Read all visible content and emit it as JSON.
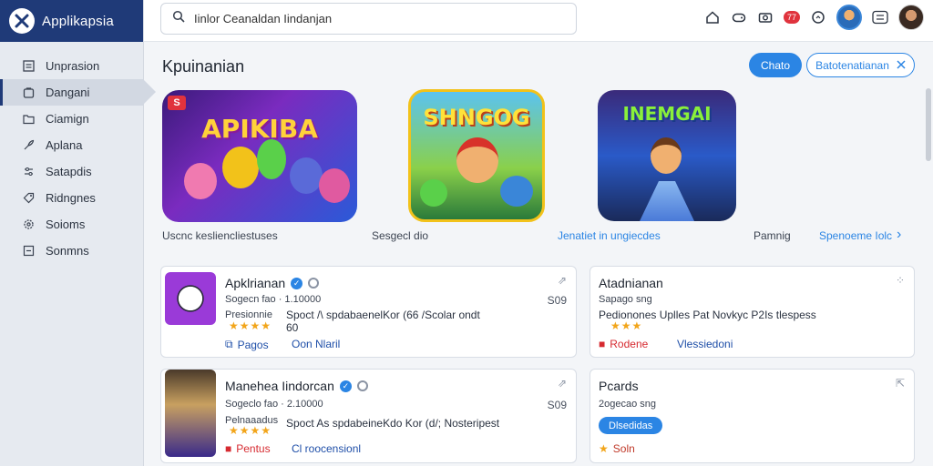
{
  "app": {
    "name": "Applikapsia"
  },
  "search": {
    "value": "Iinlor Ceanaldan Iindanjan"
  },
  "topbar": {
    "notif_count": "77"
  },
  "sidebar": {
    "items": [
      {
        "label": "Unprasion",
        "icon": "layout-icon"
      },
      {
        "label": "Dangani",
        "icon": "bag-icon",
        "active": true
      },
      {
        "label": "Ciamign",
        "icon": "folder-icon"
      },
      {
        "label": "Aplana",
        "icon": "rocket-icon"
      },
      {
        "label": "Satapdis",
        "icon": "sliders-icon"
      },
      {
        "label": "Ridngnes",
        "icon": "tag-icon"
      },
      {
        "label": "Soioms",
        "icon": "gear-icon"
      },
      {
        "label": "Sonmns",
        "icon": "box-icon"
      }
    ]
  },
  "main": {
    "title": "Kpuinanian",
    "primary_button": "Chato",
    "outline_button": "Batotenatianan",
    "tiles": [
      {
        "art_text": "APIKIBA",
        "badge": "S",
        "label": "Uscnc kesliencliestuses"
      },
      {
        "art_text": "SHNGOG",
        "label": "Sesgecl dio"
      },
      {
        "art_text": "INEMGAI",
        "label": "Jenatiet in ungiecdes"
      }
    ],
    "extra_label": "Pamnig",
    "see_more": "Spenoeme Iolc"
  },
  "cards": [
    {
      "title": "Apklrianan",
      "meta": "Sogecn fao · 1.10000",
      "rating_label": "Presionnie",
      "desc": "Spoct /\\ spdabaenelKor (66 /Scolar ondt",
      "desc2": "60",
      "stars": "★★★★",
      "price": "S09",
      "action1": "Pagos",
      "action2": "Oon Nlaril"
    },
    {
      "title": "Manehea Iindorcan",
      "meta": "Sogeclo fao · 2.10000",
      "rating_label": "Pelnaaadus",
      "desc": "Spoct As spdabeineKdo Kor (d/; Nosteripest",
      "stars": "★★★★",
      "price": "S09",
      "action1": "Pentus",
      "action2": "Cl roocensionl"
    },
    {
      "title": "Atadnianan",
      "meta": "Sapago sng",
      "desc": "Pedionones Uplles Pat Novkyc P2Is tlespess",
      "stars": "★★★",
      "action1": "Rodene",
      "action2": "Vlessiedoni"
    },
    {
      "title": "Pcards",
      "meta": "2ogecao sng",
      "pill": "Dlsedidas",
      "action1": "Soln"
    }
  ],
  "colors": {
    "brand": "#1f3a78",
    "accent": "#2b85e4",
    "star": "#f2a51a",
    "danger": "#d62a30"
  }
}
